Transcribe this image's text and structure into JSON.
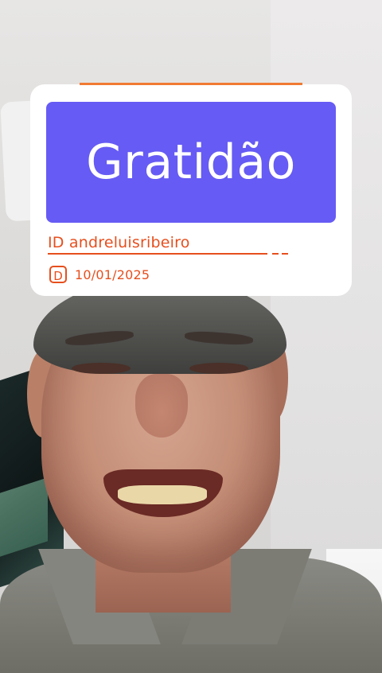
{
  "sticker": {
    "title": "Gratidão",
    "id_line": "ID  andreluisribeiro",
    "date_icon_letter": "D",
    "date": "10/01/2025"
  },
  "colors": {
    "title_card": "#665bf4",
    "accent": "#e64f1d",
    "top_accent": "#f07a33"
  },
  "icons": {
    "date_badge": "d-badge-icon"
  }
}
